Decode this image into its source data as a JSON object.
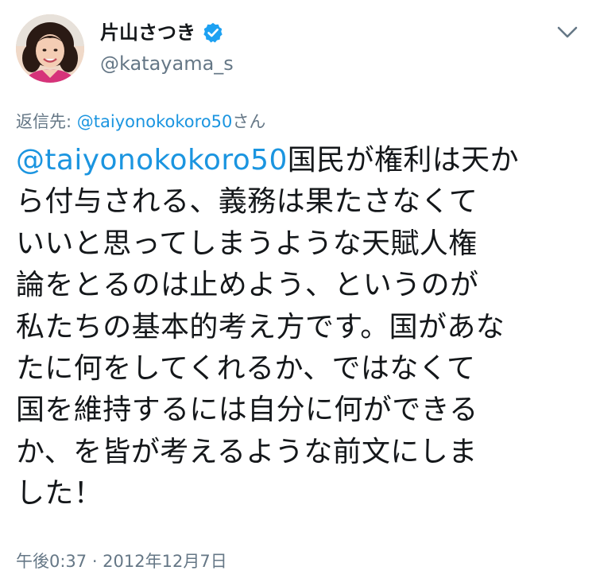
{
  "user": {
    "display_name": "片山さつき",
    "handle": "@katayama_s",
    "verified_icon": "verified-badge-icon",
    "avatar_icon": "avatar-photo"
  },
  "reply": {
    "prefix": "返信先: ",
    "mention": "@taiyonokokoro50",
    "suffix": "さん"
  },
  "tweet": {
    "mention": "@taiyonokokoro50",
    "lines": [
      "国民が権利は天か",
      "ら付与される、義務は果たさなくて",
      "いいと思ってしまうような天賦人権",
      "論をとるのは止めよう、というのが",
      "私たちの基本的考え方です。国があな",
      "たに何をしてくれるか、ではなくて",
      "国を維持するには自分に何ができる",
      "か、を皆が考えるような前文にしま",
      "した！"
    ]
  },
  "timestamp": "午後0:37 · 2012年12月7日",
  "menu": {
    "icon": "chevron-down-icon"
  },
  "colors": {
    "link": "#1b95e0",
    "secondary_text": "#657786",
    "primary_text": "#14171a"
  }
}
